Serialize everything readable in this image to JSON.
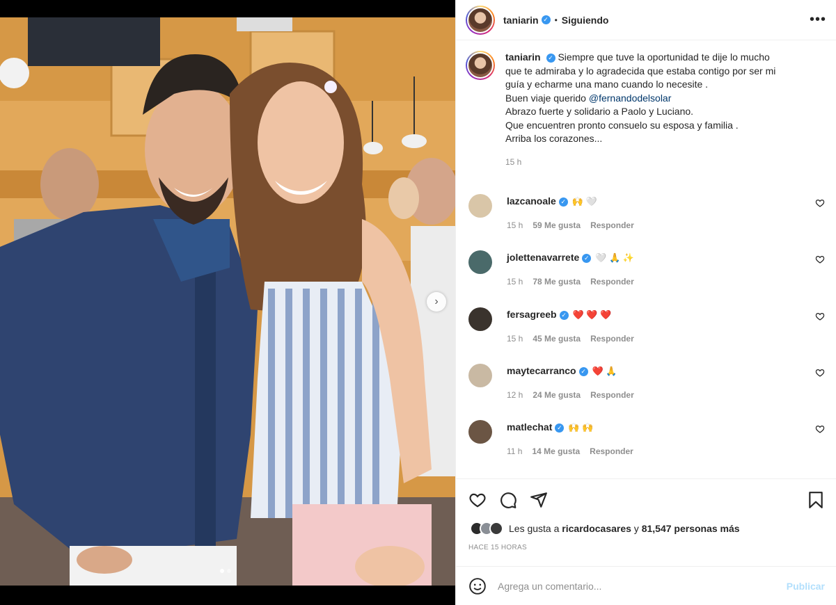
{
  "post": {
    "username": "taniarin",
    "follow_status": "Siguiendo",
    "separator": "•",
    "more_icon": "more-icon",
    "caption_lines": [
      "Siempre que tuve la oportunidad te dije lo mucho",
      "que te admiraba y lo agradecida que estaba contigo por ser mi",
      "guía y echarme una mano cuando lo necesite .",
      "Buen viaje querido ",
      "Abrazo fuerte y solidario a Paolo y Luciano.",
      "Que encuentren pronto consuelo su esposa y familia .",
      "Arriba los corazones..."
    ],
    "mention": "@fernandodelsolar",
    "caption_time": "15 h"
  },
  "comments": [
    {
      "user": "lazcanoale",
      "text": "🙌 🤍",
      "time": "15 h",
      "likes": "59 Me gusta",
      "reply": "Responder",
      "avatar_color": "#d9c6a8"
    },
    {
      "user": "jolettenavarrete",
      "text": "🤍 🙏 ✨",
      "time": "15 h",
      "likes": "78 Me gusta",
      "reply": "Responder",
      "avatar_color": "#4a6a6a"
    },
    {
      "user": "fersagreeb",
      "text": "❤️ ❤️ ❤️",
      "time": "15 h",
      "likes": "45 Me gusta",
      "reply": "Responder",
      "avatar_color": "#3a332d"
    },
    {
      "user": "maytecarranco",
      "text": "❤️ 🙏",
      "time": "12 h",
      "likes": "24 Me gusta",
      "reply": "Responder",
      "avatar_color": "#c9b9a3"
    },
    {
      "user": "matlechat",
      "text": "🙌 🙌",
      "time": "11 h",
      "likes": "14 Me gusta",
      "reply": "Responder",
      "avatar_color": "#6b5544"
    }
  ],
  "likes": {
    "prefix": "Les gusta a ",
    "user": "ricardocasares",
    "middle": " y ",
    "count": "81,547 personas más"
  },
  "posted_ago": "HACE 15 HORAS",
  "comment_box": {
    "placeholder": "Agrega un comentario...",
    "publish_label": "Publicar"
  },
  "carousel": {
    "current_slide": 1,
    "total_slides": 2
  }
}
